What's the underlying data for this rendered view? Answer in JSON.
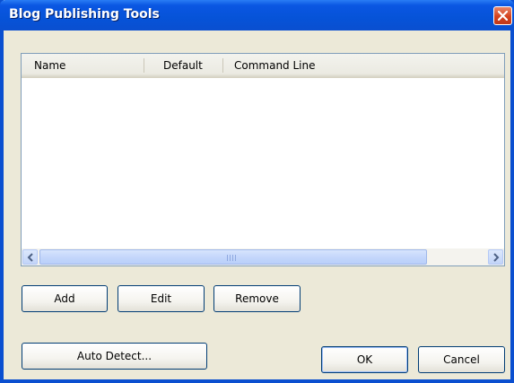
{
  "window": {
    "title": "Blog Publishing Tools"
  },
  "listview": {
    "columns": [
      "Name",
      "Default",
      "Command Line"
    ],
    "rows": []
  },
  "buttons": {
    "add": "Add",
    "edit": "Edit",
    "remove": "Remove",
    "auto_detect": "Auto Detect...",
    "ok": "OK",
    "cancel": "Cancel"
  },
  "icons": {
    "close": "close-icon",
    "scroll_left": "arrow-left-icon",
    "scroll_right": "arrow-right-icon",
    "grip": "scrollbar-grip-icon"
  },
  "colors": {
    "titlebar": "#0a56e2",
    "close_button": "#d4421e",
    "dialog_bg": "#ece9d8",
    "button_border": "#003c74"
  }
}
